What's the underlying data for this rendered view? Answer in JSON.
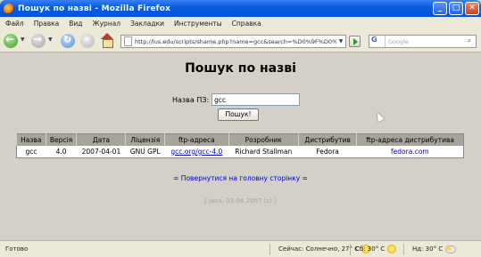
{
  "window": {
    "title": "Пошук по назві - Mozilla Firefox"
  },
  "menu": [
    "Файл",
    "Правка",
    "Вид",
    "Журнал",
    "Закладки",
    "Инструменты",
    "Справка"
  ],
  "toolbar": {
    "url": "http://lus.edu/scripts/shame.php?name=gcc&search=%D0%9F%D0%BE%D1%88%D1%83",
    "search_placeholder": "Google"
  },
  "page": {
    "heading": "Пошук по назві",
    "form_label": "Назва ПЗ:",
    "input_value": "gcc",
    "submit_label": "Пошук!",
    "table": {
      "headers": [
        "Назва",
        "Версія",
        "Дата",
        "Ліцензія",
        "ftp-адреса",
        "Розробник",
        "Дистрибутив",
        "ftp-адреса дистрибутива"
      ],
      "rows": [
        [
          "gcc",
          "4.0",
          "2007-04-01",
          "GNU GPL",
          "gcc.org/gcc-4.0",
          "Richard Stallman",
          "Fedora",
          "fedora.com"
        ]
      ]
    },
    "back_link": "= Повернутися на головну сторінку =",
    "footer_note": "[ Java, 03.04.2007 (c) ]"
  },
  "status": {
    "text": "Готово",
    "weather_today": "Сейчас: Солнечно, 27° C",
    "weather_day2": "Сб: 30° C",
    "weather_day3": "Нд: 30° C"
  }
}
